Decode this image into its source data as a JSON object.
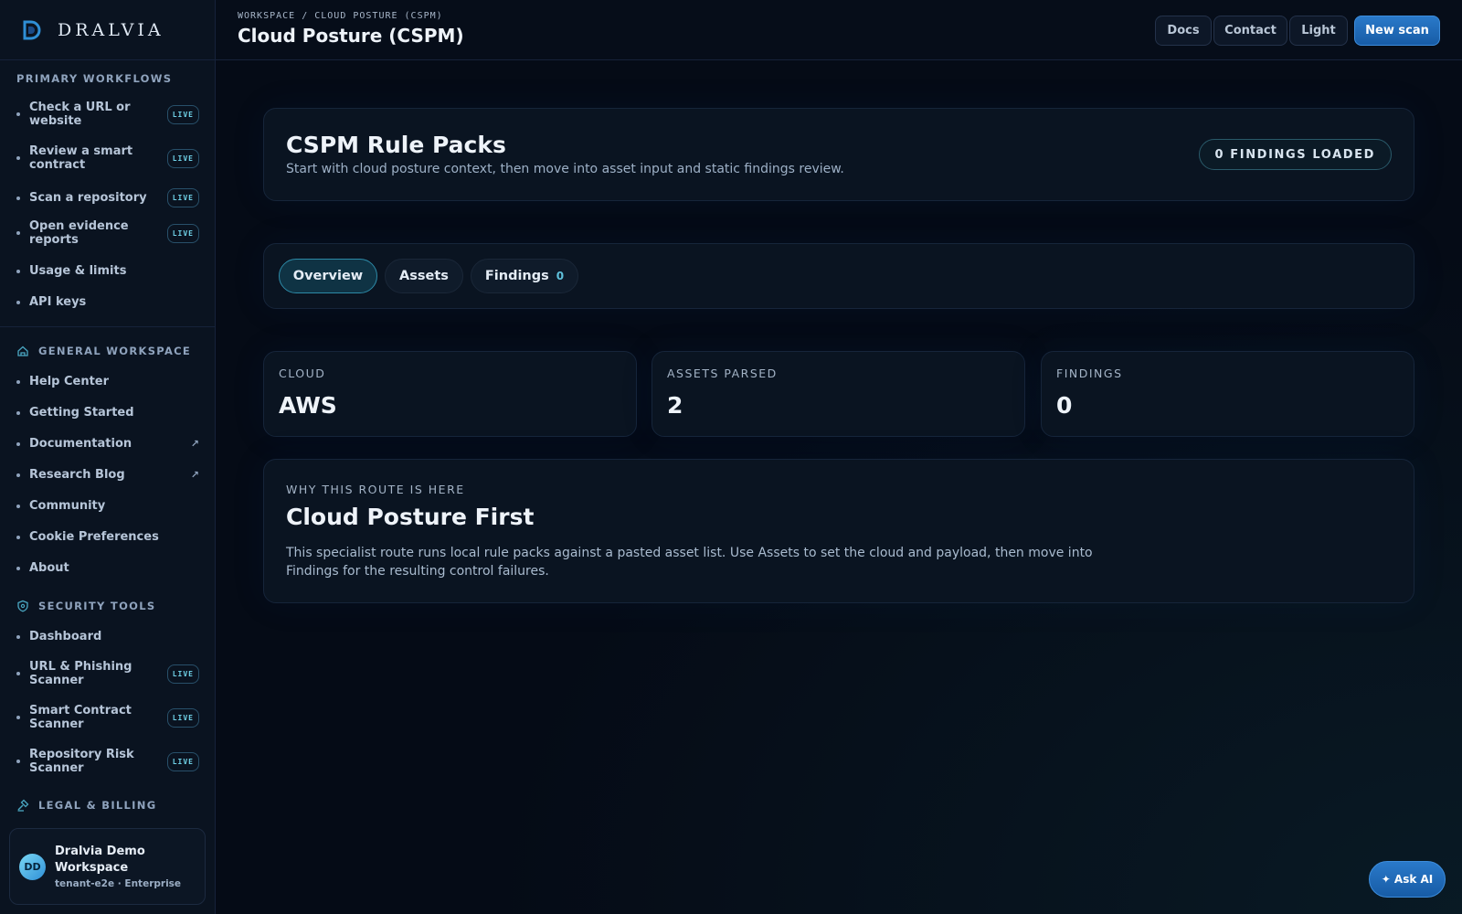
{
  "brand": {
    "name": "DRALVIA",
    "logo_icon": "dralvia-logo-icon"
  },
  "sidebar": {
    "primary": {
      "title": "PRIMARY WORKFLOWS",
      "items": [
        {
          "label": "Check a URL or website",
          "badge": "LIVE"
        },
        {
          "label": "Review a smart contract",
          "badge": "LIVE"
        },
        {
          "label": "Scan a repository",
          "badge": "LIVE"
        },
        {
          "label": "Open evidence reports",
          "badge": "LIVE"
        },
        {
          "label": "Usage & limits"
        },
        {
          "label": "API keys"
        }
      ]
    },
    "general": {
      "title": "GENERAL WORKSPACE",
      "icon": "home-icon",
      "items": [
        {
          "label": "Help Center"
        },
        {
          "label": "Getting Started"
        },
        {
          "label": "Documentation",
          "ext": "↗"
        },
        {
          "label": "Research Blog",
          "ext": "↗"
        },
        {
          "label": "Community"
        },
        {
          "label": "Cookie Preferences"
        },
        {
          "label": "About"
        }
      ]
    },
    "security": {
      "title": "SECURITY TOOLS",
      "icon": "shield-icon",
      "items": [
        {
          "label": "Dashboard"
        },
        {
          "label": "URL & Phishing Scanner",
          "badge": "LIVE"
        },
        {
          "label": "Smart Contract Scanner",
          "badge": "LIVE"
        },
        {
          "label": "Repository Risk Scanner",
          "badge": "LIVE"
        }
      ]
    },
    "legal": {
      "title": "LEGAL & BILLING",
      "icon": "gavel-icon"
    },
    "workspace": {
      "avatar": "DD",
      "name": "Dralvia Demo Workspace",
      "sub": "tenant-e2e · Enterprise"
    }
  },
  "header": {
    "breadcrumb": "WORKSPACE / CLOUD POSTURE (CSPM)",
    "title": "Cloud Posture (CSPM)",
    "buttons": {
      "docs": "Docs",
      "contact": "Contact",
      "theme": "Light",
      "new_scan": "New scan"
    }
  },
  "hero": {
    "title": "CSPM Rule Packs",
    "subtitle": "Start with cloud posture context, then move into asset input and static findings review.",
    "badge": "0 FINDINGS LOADED"
  },
  "tabs": [
    {
      "label": "Overview",
      "active": true
    },
    {
      "label": "Assets"
    },
    {
      "label": "Findings",
      "count": "0"
    }
  ],
  "stats": [
    {
      "label": "CLOUD",
      "value": "AWS"
    },
    {
      "label": "ASSETS PARSED",
      "value": "2"
    },
    {
      "label": "FINDINGS",
      "value": "0"
    }
  ],
  "why": {
    "eyebrow": "WHY THIS ROUTE IS HERE",
    "title": "Cloud Posture First",
    "body": "This specialist route runs local rule packs against a pasted asset list. Use Assets to set the cloud and payload, then move into Findings for the resulting control failures."
  },
  "ask_ai": "✦ Ask AI",
  "colors": {
    "accent": "#2a79c9",
    "live": "#6fd0e6",
    "background": "#050b16"
  }
}
